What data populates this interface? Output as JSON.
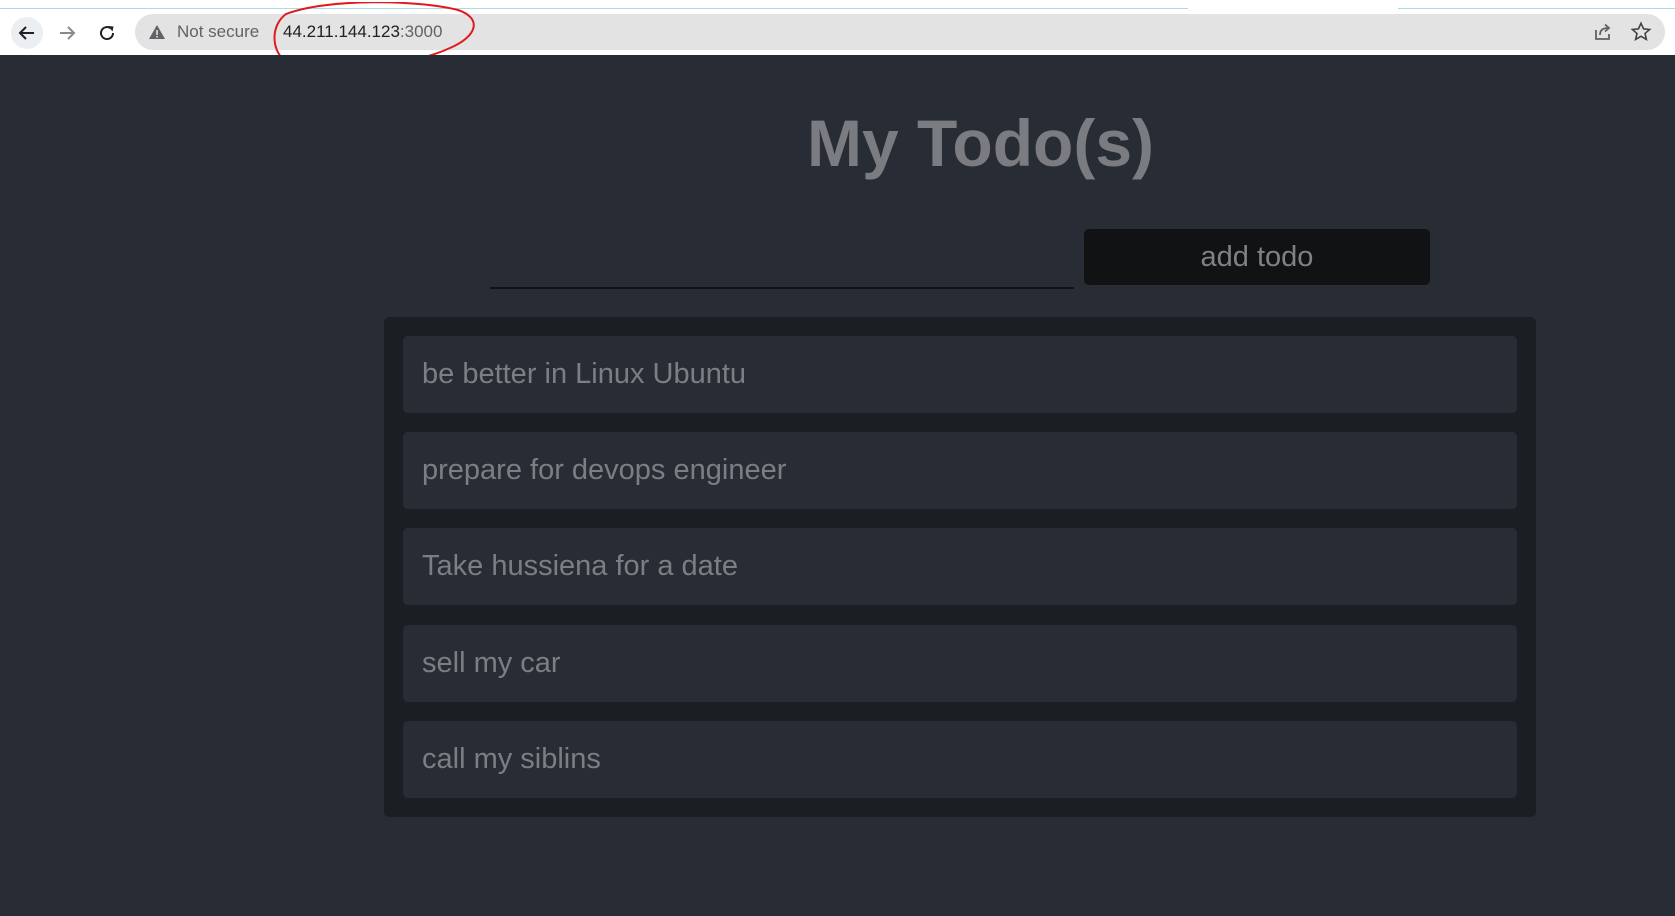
{
  "browser": {
    "security_label": "Not secure",
    "url_host": "44.211.144.123",
    "url_port": ":3000"
  },
  "app": {
    "title": "My Todo(s)",
    "input": {
      "value": "",
      "placeholder": ""
    },
    "add_button_label": "add todo",
    "todos": [
      "be better in Linux Ubuntu",
      "prepare for devops engineer",
      "Take hussiena for a date",
      "sell my car",
      "call my siblins"
    ]
  },
  "colors": {
    "page_bg": "#282c34",
    "list_bg": "#1b1e22",
    "button_bg": "#101214",
    "annotation": "#e0191e"
  }
}
